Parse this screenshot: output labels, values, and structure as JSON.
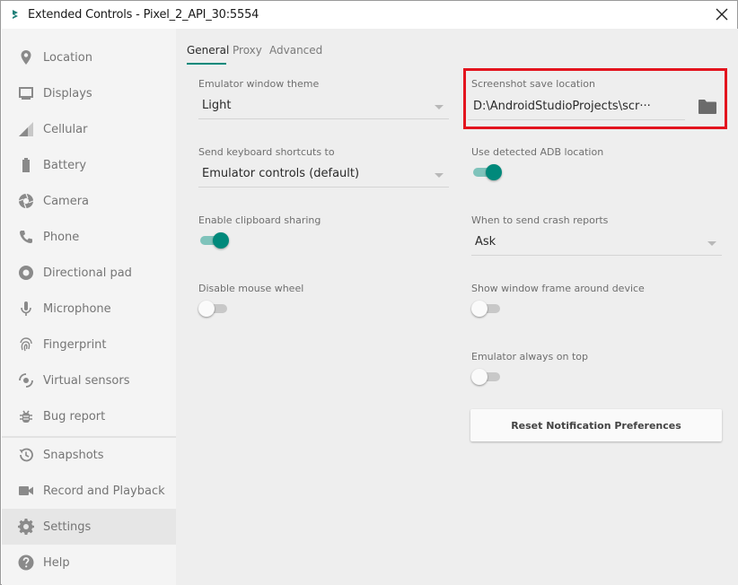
{
  "window": {
    "title": "Extended Controls - Pixel_2_API_30:5554",
    "icon": "android-studio-icon",
    "close_icon": "close-icon"
  },
  "sidebar": {
    "items": [
      {
        "label": "Location",
        "icon": "location-pin-icon"
      },
      {
        "label": "Displays",
        "icon": "display-icon"
      },
      {
        "label": "Cellular",
        "icon": "cellular-signal-icon"
      },
      {
        "label": "Battery",
        "icon": "battery-icon"
      },
      {
        "label": "Camera",
        "icon": "camera-icon"
      },
      {
        "label": "Phone",
        "icon": "phone-icon"
      },
      {
        "label": "Directional pad",
        "icon": "dpad-icon"
      },
      {
        "label": "Microphone",
        "icon": "microphone-icon"
      },
      {
        "label": "Fingerprint",
        "icon": "fingerprint-icon"
      },
      {
        "label": "Virtual sensors",
        "icon": "sensor-icon"
      },
      {
        "label": "Bug report",
        "icon": "bug-icon"
      },
      {
        "label": "Snapshots",
        "icon": "history-icon"
      },
      {
        "label": "Record and Playback",
        "icon": "videocam-icon"
      },
      {
        "label": "Settings",
        "icon": "gear-icon"
      },
      {
        "label": "Help",
        "icon": "help-icon"
      }
    ],
    "active": "Settings"
  },
  "tabs": [
    {
      "label": "General",
      "active": true
    },
    {
      "label": "Proxy",
      "active": false
    },
    {
      "label": "Advanced",
      "active": false
    }
  ],
  "settings": {
    "theme": {
      "label": "Emulator window theme",
      "value": "Light"
    },
    "shortcuts": {
      "label": "Send keyboard shortcuts to",
      "value": "Emulator controls (default)"
    },
    "clipboard": {
      "label": "Enable clipboard sharing",
      "on": true
    },
    "mousewheel": {
      "label": "Disable mouse wheel",
      "on": false
    },
    "screenshot": {
      "label": "Screenshot save location",
      "value": "D:\\AndroidStudioProjects\\scr···",
      "icon": "folder-icon"
    },
    "adb": {
      "label": "Use detected ADB location",
      "on": true
    },
    "crash": {
      "label": "When to send crash reports",
      "value": "Ask"
    },
    "frame": {
      "label": "Show window frame around device",
      "on": false
    },
    "ontop": {
      "label": "Emulator always on top",
      "on": false
    },
    "reset_button": "Reset Notification Preferences"
  },
  "colors": {
    "accent": "#00897b",
    "highlight": "#e3141e"
  }
}
